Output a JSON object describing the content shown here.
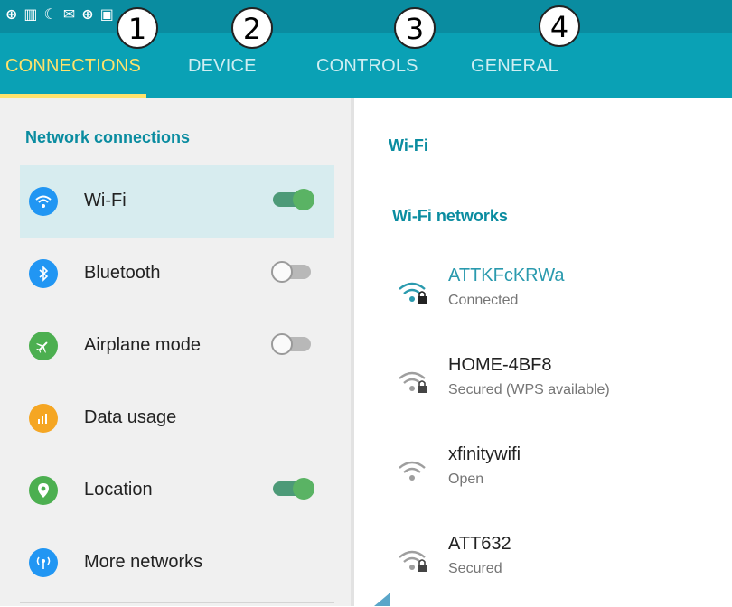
{
  "status_bar": {
    "icons": [
      "notification-icon-1",
      "notification-icon-2",
      "notification-icon-3",
      "notification-icon-4",
      "notification-icon-5",
      "notification-icon-6"
    ]
  },
  "tabs": [
    {
      "label": "CONNECTIONS",
      "active": true,
      "badge": "1"
    },
    {
      "label": "DEVICE",
      "active": false,
      "badge": "2"
    },
    {
      "label": "CONTROLS",
      "active": false,
      "badge": "3"
    },
    {
      "label": "GENERAL",
      "active": false,
      "badge": "4"
    }
  ],
  "left": {
    "section_title": "Network connections",
    "items": [
      {
        "label": "Wi-Fi",
        "icon": "wifi-icon",
        "icon_color": "#2196f3",
        "toggle": "on",
        "selected": true
      },
      {
        "label": "Bluetooth",
        "icon": "bluetooth-icon",
        "icon_color": "#2196f3",
        "toggle": "off"
      },
      {
        "label": "Airplane mode",
        "icon": "airplane-icon",
        "icon_color": "#4caf50",
        "toggle": "off"
      },
      {
        "label": "Data usage",
        "icon": "data-usage-icon",
        "icon_color": "#f5a623"
      },
      {
        "label": "Location",
        "icon": "location-icon",
        "icon_color": "#4caf50",
        "toggle": "on"
      },
      {
        "label": "More networks",
        "icon": "more-networks-icon",
        "icon_color": "#2196f3"
      }
    ]
  },
  "right": {
    "title": "Wi-Fi",
    "networks_title": "Wi-Fi networks",
    "networks": [
      {
        "name": "ATTKFcKRWa",
        "status": "Connected",
        "connected": true,
        "locked": true
      },
      {
        "name": "HOME-4BF8",
        "status": "Secured (WPS available)",
        "connected": false,
        "locked": true
      },
      {
        "name": "xfinitywifi",
        "status": "Open",
        "connected": false,
        "locked": false
      },
      {
        "name": "ATT632",
        "status": "Secured",
        "connected": false,
        "locked": true
      }
    ]
  },
  "colors": {
    "accent": "#0aa1b5",
    "active_tab": "#ffe26b",
    "toggle_on": "#5ab364"
  }
}
